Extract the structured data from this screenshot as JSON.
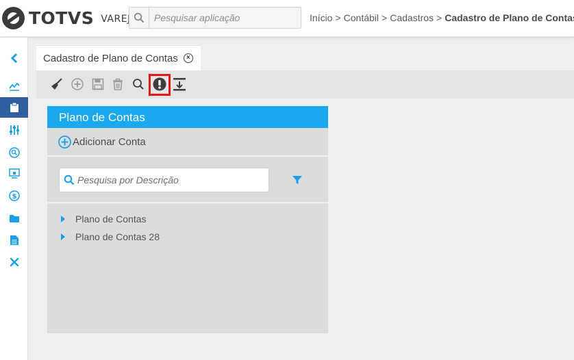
{
  "header": {
    "brand": "TOTVS",
    "brand_sub": "VAREJO",
    "search_placeholder": "Pesquisar aplicação",
    "breadcrumb": [
      "Início",
      "Contábil",
      "Cadastros"
    ],
    "breadcrumb_separator": ">",
    "breadcrumb_current": "Cadastro de Plano de Contas"
  },
  "sidebar": {
    "items": [
      {
        "icon": "chevron-left-icon"
      },
      {
        "icon": "chart-line-icon"
      },
      {
        "icon": "clipboard-icon",
        "active": true
      },
      {
        "icon": "sliders-icon"
      },
      {
        "icon": "search-circle-icon"
      },
      {
        "icon": "monitor-lock-icon"
      },
      {
        "icon": "dollar-circle-icon"
      },
      {
        "icon": "folder-icon"
      },
      {
        "icon": "document-icon"
      },
      {
        "icon": "tools-icon"
      }
    ]
  },
  "tab": {
    "title": "Cadastro de Plano de Contas",
    "close_glyph": "×"
  },
  "toolbar": {
    "buttons": [
      {
        "icon": "broom-icon",
        "enabled": true
      },
      {
        "icon": "add-circle-icon",
        "enabled": false
      },
      {
        "icon": "save-icon",
        "enabled": false
      },
      {
        "icon": "trash-icon",
        "enabled": false
      },
      {
        "icon": "search-icon",
        "enabled": true
      },
      {
        "icon": "exclamation-circle-icon",
        "enabled": true,
        "highlighted": true
      },
      {
        "icon": "download-tray-icon",
        "enabled": true
      }
    ]
  },
  "panel": {
    "title": "Plano de Contas",
    "add_label": "Adicionar Conta",
    "search_placeholder": "Pesquisa por Descrição",
    "tree_items": [
      "Plano de Contas",
      "Plano de Contas 28"
    ]
  },
  "colors": {
    "accent": "#1aa8ee",
    "sidebar_active": "#2f5fa0",
    "highlight": "#e11919",
    "icon_blue": "#1a9ee8"
  }
}
